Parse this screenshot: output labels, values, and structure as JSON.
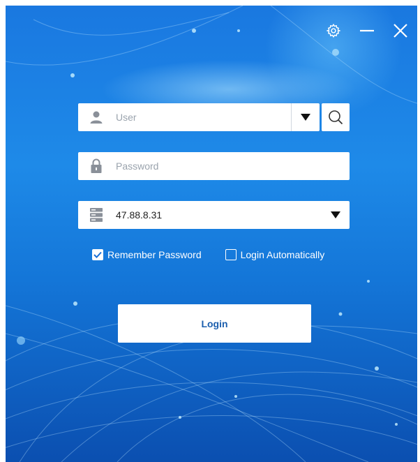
{
  "window": {
    "title_icons": [
      "gear-icon",
      "minimize-icon",
      "close-icon"
    ]
  },
  "login_form": {
    "user": {
      "placeholder": "User",
      "icon": "user-icon"
    },
    "password": {
      "placeholder": "Password",
      "icon": "lock-icon"
    },
    "server": {
      "value": "47.88.8.31",
      "icon": "server-icon"
    },
    "remember_password": {
      "label": "Remember Password",
      "checked": true
    },
    "login_automatically": {
      "label": "Login Automatically",
      "checked": false
    },
    "login_button": {
      "label": "Login"
    }
  },
  "colors": {
    "background_top": "#1a78e0",
    "background_bottom": "#0b4fb0",
    "login_text": "#1c5fae"
  }
}
